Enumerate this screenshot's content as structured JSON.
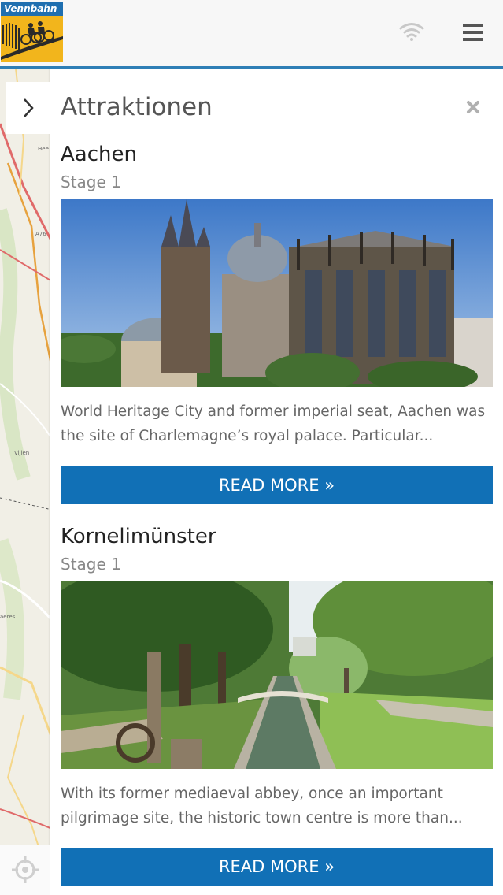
{
  "header": {
    "logo_text": "Vennbahn"
  },
  "map": {
    "labels": [
      "Hee",
      "A76",
      "Vijlen",
      "aeres"
    ]
  },
  "panel": {
    "title": "Attraktionen"
  },
  "attractions": [
    {
      "title": "Aachen",
      "stage": "Stage 1",
      "description": "World Heritage City and former imperial seat, Aachen was the site of Charlemagne’s royal palace. Particular...",
      "button": "READ MORE »"
    },
    {
      "title": "Kornelimünster",
      "stage": "Stage 1",
      "description": "With its former mediaeval abbey, once an important pilgrimage site, the historic town centre is more than...",
      "button": "READ MORE »"
    }
  ],
  "colors": {
    "accent": "#1170b6",
    "logo_bg": "#f2b51c",
    "header_line": "#2f7fb6"
  }
}
